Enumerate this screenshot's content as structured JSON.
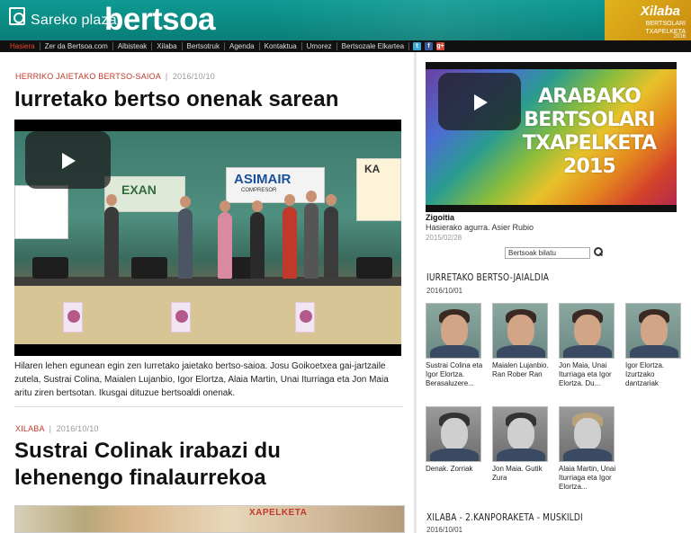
{
  "header": {
    "logo_small": "Sareko plaza",
    "logo_big": "bertsoa",
    "banner_title": "Xilaba",
    "banner_sub": "BERTSOLARI TXAPELKETA",
    "banner_year": "2016"
  },
  "nav": {
    "items": [
      "Hasiera",
      "Zer da Bertsoa.com",
      "Albisteak",
      "Xilaba",
      "Bertsotruk",
      "Agenda",
      "Kontaktua",
      "Umorez",
      "Bertsozale Elkartea"
    ],
    "social": [
      "t",
      "f",
      "g+"
    ]
  },
  "articles": [
    {
      "category": "HERRIKO JAIETAKO BERTSO-SAIOA",
      "date": "2016/10/10",
      "title": "Iurretako bertso onenak sarean",
      "video_banner": "ASIMAIR",
      "video_banner_sub": "COMPRESOR",
      "video_banner_left": "EXAN",
      "video_banner_right": "KA",
      "summary": "Hilaren lehen egunean egin zen Iurretako jaietako bertso-saioa. Josu Goikoetxea gai-jartzaile zutela, Sustrai Colina, Maialen Lujanbio, Igor Elortza, Alaia Martin, Unai Iturriaga eta Jon Maia aritu ziren bertsotan. Ikusgai dituzue bertsoaldi onenak."
    },
    {
      "category": "XILABA",
      "date": "2016/10/10",
      "title_line1": "Sustrai Colinak irabazi du",
      "title_line2": "lehenengo finalaurrekoa",
      "thumb_text": "XAPELKETA"
    }
  ],
  "sidebar": {
    "video_text": "ARABAKO BERTSOLARI TXAPELKETA 2015",
    "video_place": "Zigoitia",
    "video_desc": "Hasierako agurra. Asier Rubio",
    "video_date": "2015/02/28",
    "search_placeholder": "Bertsoak bilatu",
    "section1_title": "IURRETAKO BERTSO-JAIALDIA",
    "section1_date": "2016/10/01",
    "grid": [
      "Sustrai Colina eta Igor Elortza. Berasaluzere...",
      "Maialen Lujanbio. Ran Rober Ran",
      "Jon Maia, Unai Iturriaga eta Igor Elortza. Du...",
      "Igor Elortza. Izurtzako dantzariak",
      "Denak. Zorriak",
      "Jon Maia. Gutik Zura",
      "Alaia Martin, Unai Iturriaga eta Igor Elortza..."
    ],
    "section2_title": "XILABA - 2.KANPORAKETA - MUSKILDI",
    "section2_date": "2016/10/01"
  }
}
